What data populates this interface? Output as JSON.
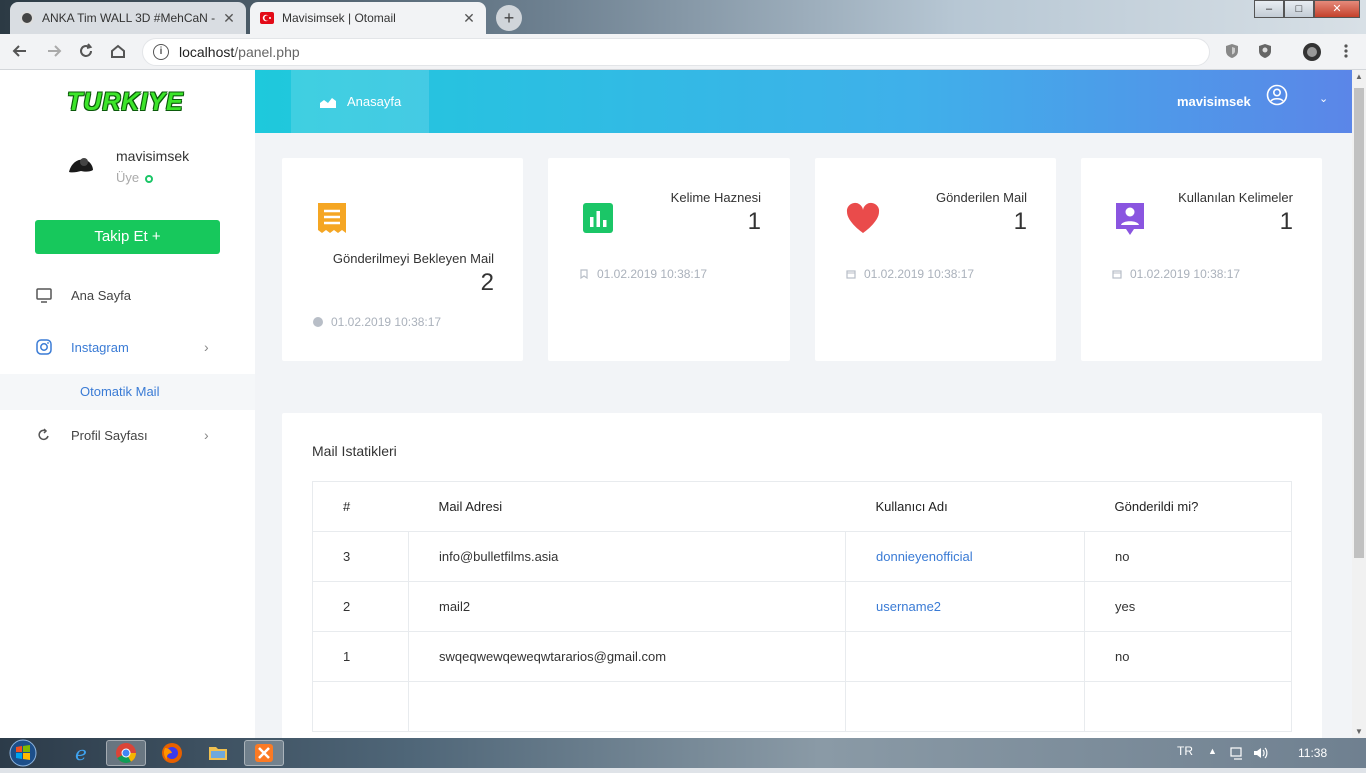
{
  "browser": {
    "tabs": [
      {
        "title": "ANKA Tim WALL 3D #MehCaN -",
        "active": false
      },
      {
        "title": "Mavisimsek | Otomail",
        "active": true
      }
    ],
    "new_tab": "+",
    "address": {
      "host": "localhost",
      "path": "/panel.php"
    },
    "window_controls": {
      "minimize": "–",
      "maximize": "□",
      "close": "✕"
    }
  },
  "sidebar": {
    "logo": "TURKIYE",
    "user": {
      "name": "mavisimsek",
      "role": "Üye"
    },
    "follow_button": "Takip Et +",
    "items": [
      {
        "label": "Ana Sayfa"
      },
      {
        "label": "Instagram",
        "expanded": true,
        "children": [
          {
            "label": "Otomatik Mail"
          }
        ]
      },
      {
        "label": "Profil Sayfası"
      }
    ],
    "chevron": "›"
  },
  "topbar": {
    "home_label": "Anasayfa",
    "username": "mavisimsek",
    "chevron": "⌄"
  },
  "cards": [
    {
      "title": "Gönderilmeyi Bekleyen Mail",
      "value": "2",
      "date": "01.02.2019 10:38:17",
      "color": "#f5a623"
    },
    {
      "title": "Kelime Haznesi",
      "value": "1",
      "date": "01.02.2019 10:38:17",
      "color": "#1bc667"
    },
    {
      "title": "Gönderilen Mail",
      "value": "1",
      "date": "01.02.2019 10:38:17",
      "color": "#ea4b4b"
    },
    {
      "title": "Kullanılan Kelimeler",
      "value": "1",
      "date": "01.02.2019 10:38:17",
      "color": "#8a55e0"
    }
  ],
  "stats": {
    "title": "Mail Istatikleri",
    "columns": [
      "#",
      "Mail Adresi",
      "Kullanıcı Adı",
      "Gönderildi mi?"
    ],
    "rows": [
      {
        "id": "3",
        "mail": "info@bulletfilms.asia",
        "user": "donnieyenofficial",
        "sent": "no"
      },
      {
        "id": "2",
        "mail": "mail2",
        "user": "username2",
        "sent": "yes"
      },
      {
        "id": "1",
        "mail": "swqeqwewqeweqwtararios@gmail.com",
        "user": "",
        "sent": "no"
      },
      {
        "id": "",
        "mail": "",
        "user": "",
        "sent": ""
      }
    ]
  },
  "taskbar": {
    "lang": "TR",
    "clock": "11:38"
  },
  "colors": {
    "accent": "#17c85c",
    "link": "#3a7bd5",
    "header_start": "#1ec9dc",
    "header_end": "#5b86e8"
  }
}
